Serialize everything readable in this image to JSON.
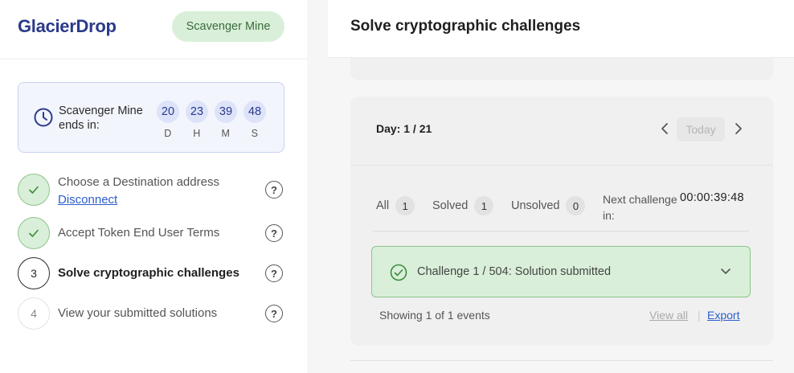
{
  "brand": {
    "logo": "GlacierDrop",
    "mine_badge": "Scavenger Mine"
  },
  "countdown": {
    "label": "Scavenger Mine ends in:",
    "units": [
      {
        "value": "20",
        "letter": "D"
      },
      {
        "value": "23",
        "letter": "H"
      },
      {
        "value": "39",
        "letter": "M"
      },
      {
        "value": "48",
        "letter": "S"
      }
    ]
  },
  "steps": [
    {
      "marker": "",
      "status": "done",
      "label": "Choose a Destination address",
      "link": "Disconnect"
    },
    {
      "marker": "",
      "status": "done",
      "label": "Accept Token End User Terms"
    },
    {
      "marker": "3",
      "status": "active",
      "label": "Solve cryptographic challenges"
    },
    {
      "marker": "4",
      "status": "pending",
      "label": "View your submitted solutions"
    }
  ],
  "main": {
    "title": "Solve cryptographic challenges",
    "day_label": "Day: 1 / 21",
    "today_button": "Today",
    "filters": [
      {
        "label": "All",
        "count": "1"
      },
      {
        "label": "Solved",
        "count": "1"
      },
      {
        "label": "Unsolved",
        "count": "0"
      }
    ],
    "next_challenge_label": "Next challenge in:",
    "next_challenge_time": "00:00:39:48",
    "challenge_text": "Challenge 1 / 504: Solution submitted",
    "showing_text": "Showing 1 of 1 events",
    "view_all": "View all",
    "export": "Export"
  },
  "colors": {
    "brand": "#2a3a8c",
    "success_bg": "#d9efd9",
    "success_border": "#8cc58c",
    "link": "#2a5dcc"
  },
  "icons": [
    "clock-icon",
    "check-icon",
    "help-icon",
    "chevron-left-icon",
    "chevron-right-icon",
    "check-circle-icon",
    "chevron-down-icon"
  ]
}
